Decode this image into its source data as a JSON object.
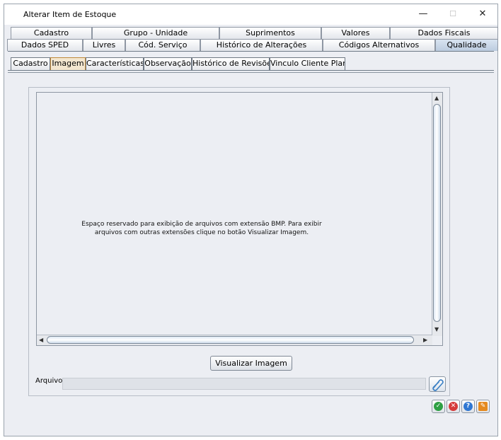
{
  "window": {
    "title": "Alterar Item de Estoque",
    "minimize_glyph": "—",
    "maximize_glyph": "☐",
    "close_glyph": "✕"
  },
  "tabs_row1": [
    "Cadastro",
    "Grupo - Unidade",
    "Suprimentos",
    "Valores",
    "Dados Fiscais"
  ],
  "tabs_row2": [
    "Dados SPED",
    "Livres",
    "Cód. Serviço",
    "Histórico de Alterações",
    "Códigos Alternativos",
    "Qualidade"
  ],
  "active_main_tab": "Qualidade",
  "subtabs": [
    "Cadastro",
    "Imagem",
    "Características",
    "Observação",
    "Histórico de Revisões",
    "Vinculo Cliente Plano"
  ],
  "active_subtab": "Imagem",
  "image_area": {
    "message": "Espaço reservado para exibição de arquivos com extensão BMP. Para exibir arquivos com outras extensões clique no botão Visualizar Imagem."
  },
  "buttons": {
    "visualizar": "Visualizar Imagem"
  },
  "file": {
    "label": "Arquivo",
    "value": ""
  },
  "action_icons": [
    "confirm-icon",
    "cancel-icon",
    "help-icon",
    "tools-icon"
  ],
  "colors": {
    "active_tab": "#bcccdf",
    "active_subtab_border": "#c08a3c",
    "confirm": "#2ea043",
    "cancel": "#d63b3b",
    "help": "#2f77d2",
    "tools": "#e58a1f"
  }
}
